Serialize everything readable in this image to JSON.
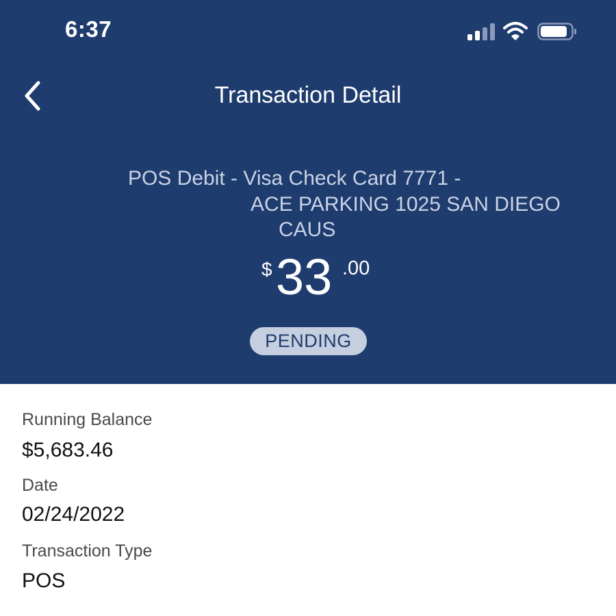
{
  "status_bar": {
    "time": "6:37",
    "icons": [
      "signal-icon",
      "wifi-icon",
      "battery-icon"
    ]
  },
  "colors": {
    "header_bg": "#1f3c6e",
    "badge_bg": "#c6cfdf",
    "badge_text": "#1f3c6e",
    "description_text": "#c9d3e6"
  },
  "nav": {
    "back_icon": "chevron-left-icon",
    "title": "Transaction Detail"
  },
  "transaction": {
    "description_lines": [
      "POS Debit - Visa Check Card 7771 -",
      "ACE PARKING 1025 SAN DIEGO",
      "CAUS"
    ],
    "amount": {
      "currency_symbol": "$",
      "whole": "33",
      "cents": ".00"
    },
    "status": "PENDING"
  },
  "details": [
    {
      "label": "Running Balance",
      "value": "$5,683.46"
    },
    {
      "label": "Date",
      "value": "02/24/2022"
    },
    {
      "label": "Transaction Type",
      "value": "POS"
    }
  ]
}
